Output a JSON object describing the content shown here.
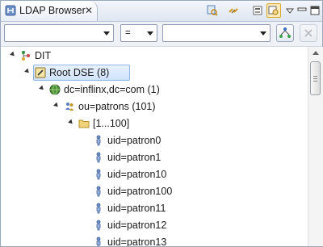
{
  "view": {
    "title": "LDAP Browser",
    "close_glyph": "✕"
  },
  "toolbar": {
    "buttons": [
      {
        "name": "search-icon",
        "selected": false
      },
      {
        "name": "link-with-editor-icon",
        "selected": false
      },
      {
        "name": "collapse-all-icon",
        "selected": false
      },
      {
        "name": "quick-search-icon",
        "selected": true
      },
      {
        "name": "view-menu-icon",
        "selected": false
      },
      {
        "name": "minimize-icon",
        "selected": false
      },
      {
        "name": "maximize-icon",
        "selected": false
      }
    ]
  },
  "filter": {
    "attribute_value": "",
    "operator_value": "=",
    "value_value": ""
  },
  "tree": [
    {
      "label": "DIT",
      "icon": "dit-icon",
      "depth": 0
    },
    {
      "label": "Root DSE (8)",
      "icon": "root-dse-icon",
      "depth": 1,
      "selected": true
    },
    {
      "label": "dc=inflinx,dc=com (1)",
      "icon": "globe-icon",
      "depth": 2
    },
    {
      "label": "ou=patrons (101)",
      "icon": "group-icon",
      "depth": 3
    },
    {
      "label": "[1...100]",
      "icon": "folder-icon",
      "depth": 4
    },
    {
      "label": "uid=patron0",
      "icon": "person-icon",
      "depth": 5
    },
    {
      "label": "uid=patron1",
      "icon": "person-icon",
      "depth": 5
    },
    {
      "label": "uid=patron10",
      "icon": "person-icon",
      "depth": 5
    },
    {
      "label": "uid=patron100",
      "icon": "person-icon",
      "depth": 5
    },
    {
      "label": "uid=patron11",
      "icon": "person-icon",
      "depth": 5
    },
    {
      "label": "uid=patron12",
      "icon": "person-icon",
      "depth": 5
    },
    {
      "label": "uid=patron13",
      "icon": "person-icon",
      "depth": 5
    }
  ]
}
